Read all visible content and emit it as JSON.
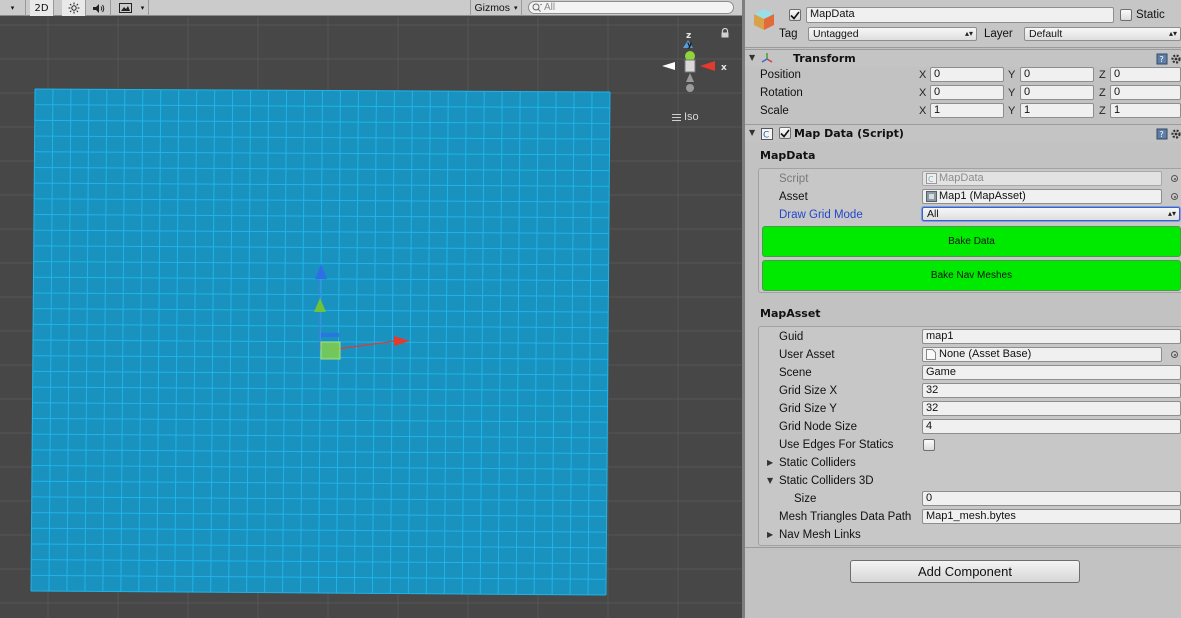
{
  "toolbar": {
    "mode_2d": "2D",
    "gizmos": "Gizmos",
    "search_placeholder": "All",
    "icons": [
      "dropdown-arrow-icon",
      "lighting-icon",
      "audio-icon",
      "effects-icon"
    ]
  },
  "scene": {
    "grid_color": "#1fb4e8",
    "grid_fill": "#1a92bf",
    "background_color": "#474747",
    "orientation": {
      "axis_z": "z",
      "axis_y": "y",
      "axis_x": "x",
      "projection": "Iso"
    }
  },
  "inspector": {
    "object_name": "MapData",
    "static_label": "Static",
    "tag_label": "Tag",
    "tag_value": "Untagged",
    "layer_label": "Layer",
    "layer_value": "Default",
    "transform": {
      "title": "Transform",
      "rows": [
        {
          "label": "Position",
          "x": "0",
          "y": "0",
          "z": "0"
        },
        {
          "label": "Rotation",
          "x": "0",
          "y": "0",
          "z": "0"
        },
        {
          "label": "Scale",
          "x": "1",
          "y": "1",
          "z": "1"
        }
      ],
      "axis_x": "X",
      "axis_y": "Y",
      "axis_z": "Z"
    },
    "map_data_script": {
      "title": "Map Data (Script)",
      "section": "MapData",
      "script_label": "Script",
      "script_value": "MapData",
      "asset_label": "Asset",
      "asset_value": "Map1 (MapAsset)",
      "draw_grid_mode_label": "Draw Grid Mode",
      "draw_grid_mode_value": "All",
      "bake_data_button": "Bake Data",
      "bake_nav_meshes_button": "Bake Nav Meshes",
      "button_color": "#00ea00"
    },
    "map_asset": {
      "section": "MapAsset",
      "guid_label": "Guid",
      "guid_value": "map1",
      "user_asset_label": "User Asset",
      "user_asset_value": "None (Asset Base)",
      "scene_label": "Scene",
      "scene_value": "Game",
      "grid_size_x_label": "Grid Size X",
      "grid_size_x_value": "32",
      "grid_size_y_label": "Grid Size Y",
      "grid_size_y_value": "32",
      "grid_node_size_label": "Grid Node Size",
      "grid_node_size_value": "4",
      "use_edges_label": "Use Edges For Statics",
      "use_edges_checked": false,
      "static_colliders_label": "Static Colliders",
      "static_colliders_3d_label": "Static Colliders 3D",
      "size_label": "Size",
      "size_value": "0",
      "mesh_path_label": "Mesh Triangles Data Path",
      "mesh_path_value": "Map1_mesh.bytes",
      "nav_mesh_links_label": "Nav Mesh Links"
    },
    "add_component_button": "Add Component"
  }
}
